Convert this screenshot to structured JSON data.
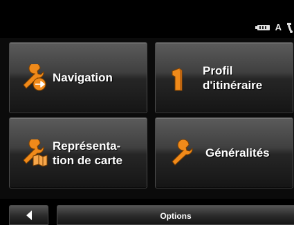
{
  "status": {
    "icons": [
      "battery-icon",
      "gps-signal-icon",
      "satellite-icon"
    ],
    "signal_letter": "A"
  },
  "menu": {
    "tiles": [
      {
        "label": "Navigation",
        "icon": "wrench-arrow-icon"
      },
      {
        "label": "Profil\nd'itinéraire",
        "icon": "route-profile-icon"
      },
      {
        "label": "Représenta-\ntion de carte",
        "icon": "wrench-map-icon"
      },
      {
        "label": "Généralités",
        "icon": "wrench-icon"
      }
    ]
  },
  "bottom": {
    "back_icon": "back-arrow-icon",
    "options_label": "Options"
  },
  "colors": {
    "accent_orange": "#f08a1a",
    "background": "#000000",
    "text": "#ffffff"
  }
}
